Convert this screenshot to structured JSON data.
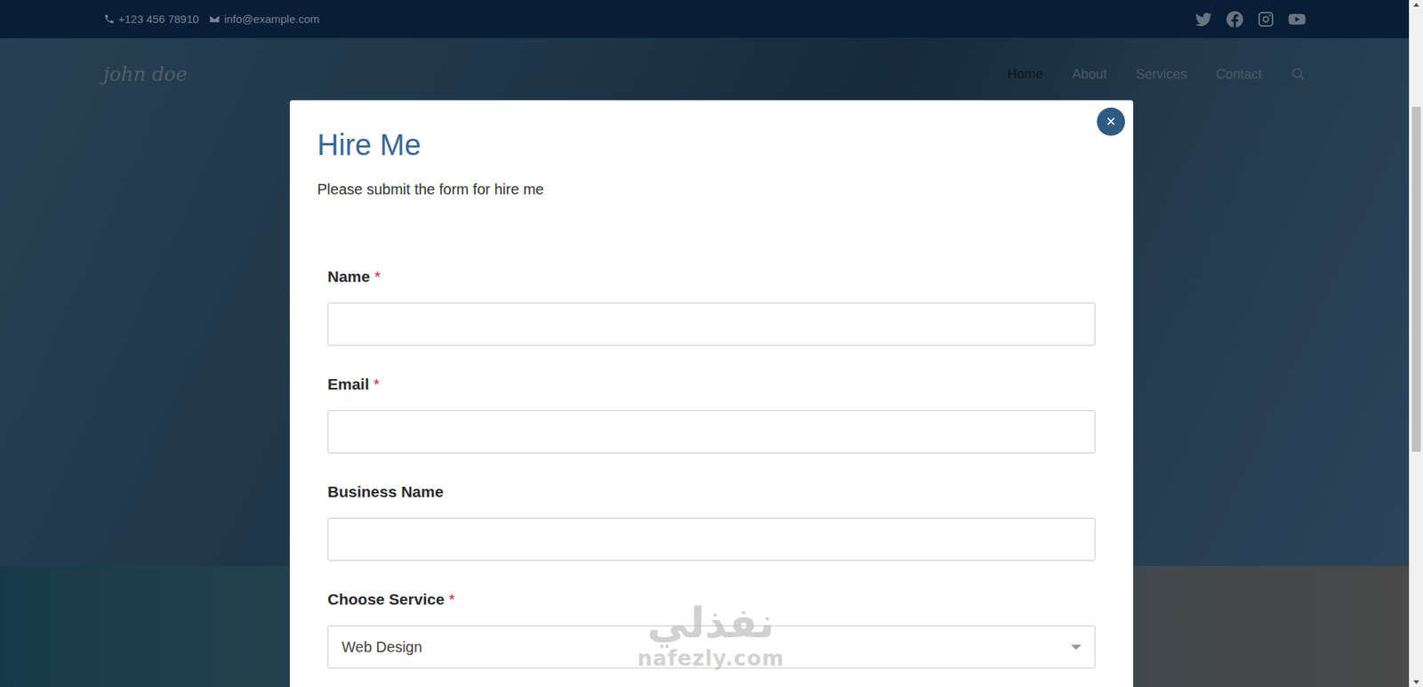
{
  "topbar": {
    "phone": "+123 456 78910",
    "email": "info@example.com"
  },
  "nav": {
    "logo": "john doe",
    "items": [
      {
        "label": "Home",
        "selected": true
      },
      {
        "label": "About",
        "selected": false
      },
      {
        "label": "Services",
        "selected": false
      },
      {
        "label": "Contact",
        "selected": false
      }
    ]
  },
  "modal": {
    "close": "×",
    "title": "Hire Me",
    "subtitle": "Please submit the form for hire me",
    "required_mark": "*",
    "fields": [
      {
        "label": "Name",
        "required": true,
        "kind": "text",
        "value": ""
      },
      {
        "label": "Email",
        "required": true,
        "kind": "text",
        "value": ""
      },
      {
        "label": "Business Name",
        "required": false,
        "kind": "text",
        "value": ""
      },
      {
        "label": "Choose Service",
        "required": true,
        "kind": "select",
        "value": "Web Design"
      }
    ]
  },
  "watermark": {
    "arabic": "نفذلي",
    "latin": "nafezly.com"
  }
}
